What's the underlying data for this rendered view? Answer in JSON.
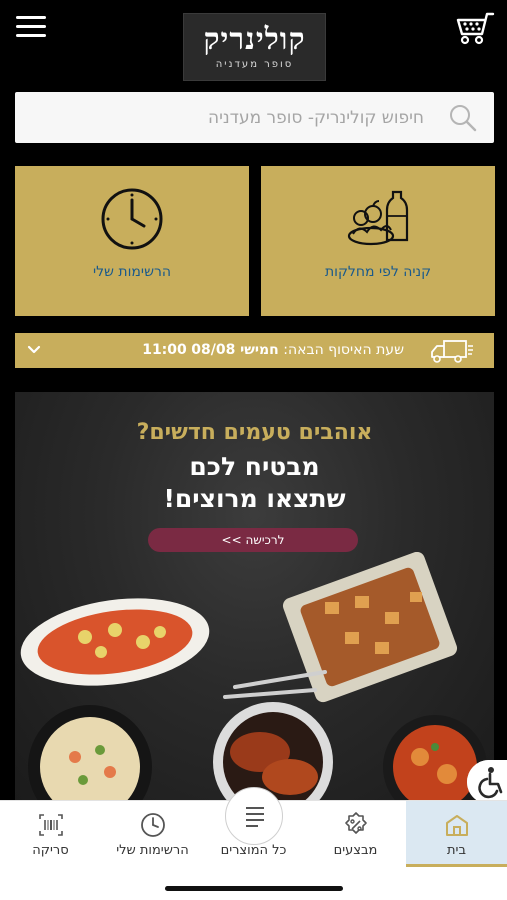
{
  "header": {
    "logo_title": "קולינריק",
    "logo_subtitle": "סופר מעדניה",
    "menu_icon": "hamburger-menu-icon",
    "cart_icon": "shopping-cart-icon"
  },
  "search": {
    "placeholder": "חיפוש קולינריק- סופר מעדניה",
    "icon": "search-icon"
  },
  "tiles": {
    "departments_label": "קניה לפי מחלקות",
    "departments_icon": "groceries-icon",
    "lists_label": "הרשימות שלי",
    "lists_icon": "clock-icon"
  },
  "pickup": {
    "prefix": "שעת האיסוף הבאה:",
    "day_date": "חמישי 08/08",
    "time": "11:00",
    "icon": "delivery-truck-icon",
    "chevron_icon": "chevron-down-icon"
  },
  "banner": {
    "line1": "אוהבים טעמים חדשים?",
    "line2": "מבטיח לכם",
    "line3": "שתצאו מרוצים!",
    "cta": "לרכישה >>"
  },
  "tabbar": {
    "home": "בית",
    "deals": "מבצעים",
    "all_products": "כל המוצרים",
    "my_lists": "הרשימות שלי",
    "scan": "סריקה",
    "active": "home"
  },
  "colors": {
    "gold": "#c8ae5c",
    "link_blue": "#1a5a8c",
    "cta_maroon": "#7a2a43",
    "active_tab_bg": "#dbe8f2"
  }
}
